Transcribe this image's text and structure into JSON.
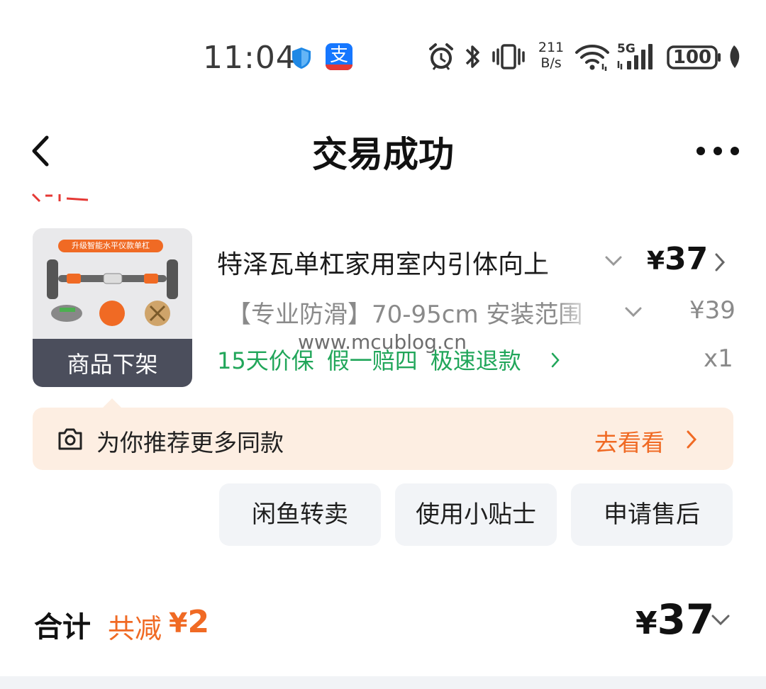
{
  "status_bar": {
    "time": "11:04",
    "net_speed_value": "211",
    "net_speed_unit": "B/s",
    "signal_label": "5G",
    "battery": "100",
    "alipay_glyph": "支"
  },
  "nav": {
    "title": "交易成功"
  },
  "product": {
    "image_banner": "升级智能水平仪款单杠",
    "delisted_label": "商品下架",
    "title": "特泽瓦单杠家用室内引体向上",
    "price_symbol": "¥",
    "price": "37",
    "sku": "【专业防滑】70-95cm 安装范围",
    "original_price": "¥39",
    "services": [
      "15天价保",
      "假一赔四",
      "极速退款"
    ],
    "quantity": "x1"
  },
  "watermark": "www.mcublog.cn",
  "recommend": {
    "text": "为你推荐更多同款",
    "link": "去看看"
  },
  "actions": {
    "resell": "闲鱼转卖",
    "tips": "使用小贴士",
    "after_sale": "申请售后"
  },
  "total": {
    "label": "合计",
    "discount_label": "共减",
    "discount_symbol": "¥",
    "discount_amount": "2",
    "price_symbol": "¥",
    "price": "37"
  },
  "colors": {
    "accent_orange": "#f06a24",
    "service_green": "#21a65a",
    "recommend_bg": "#fdeee2",
    "button_bg": "#f2f4f7",
    "alipay_blue": "#1677ff"
  },
  "icons": [
    "shield-icon",
    "alipay-icon",
    "alarm-icon",
    "bluetooth-icon",
    "vibrate-icon",
    "wifi-icon",
    "signal-icon",
    "battery-icon",
    "leaf-icon",
    "back-icon",
    "more-icon",
    "chevron-down-icon",
    "chevron-right-icon",
    "camera-icon"
  ]
}
